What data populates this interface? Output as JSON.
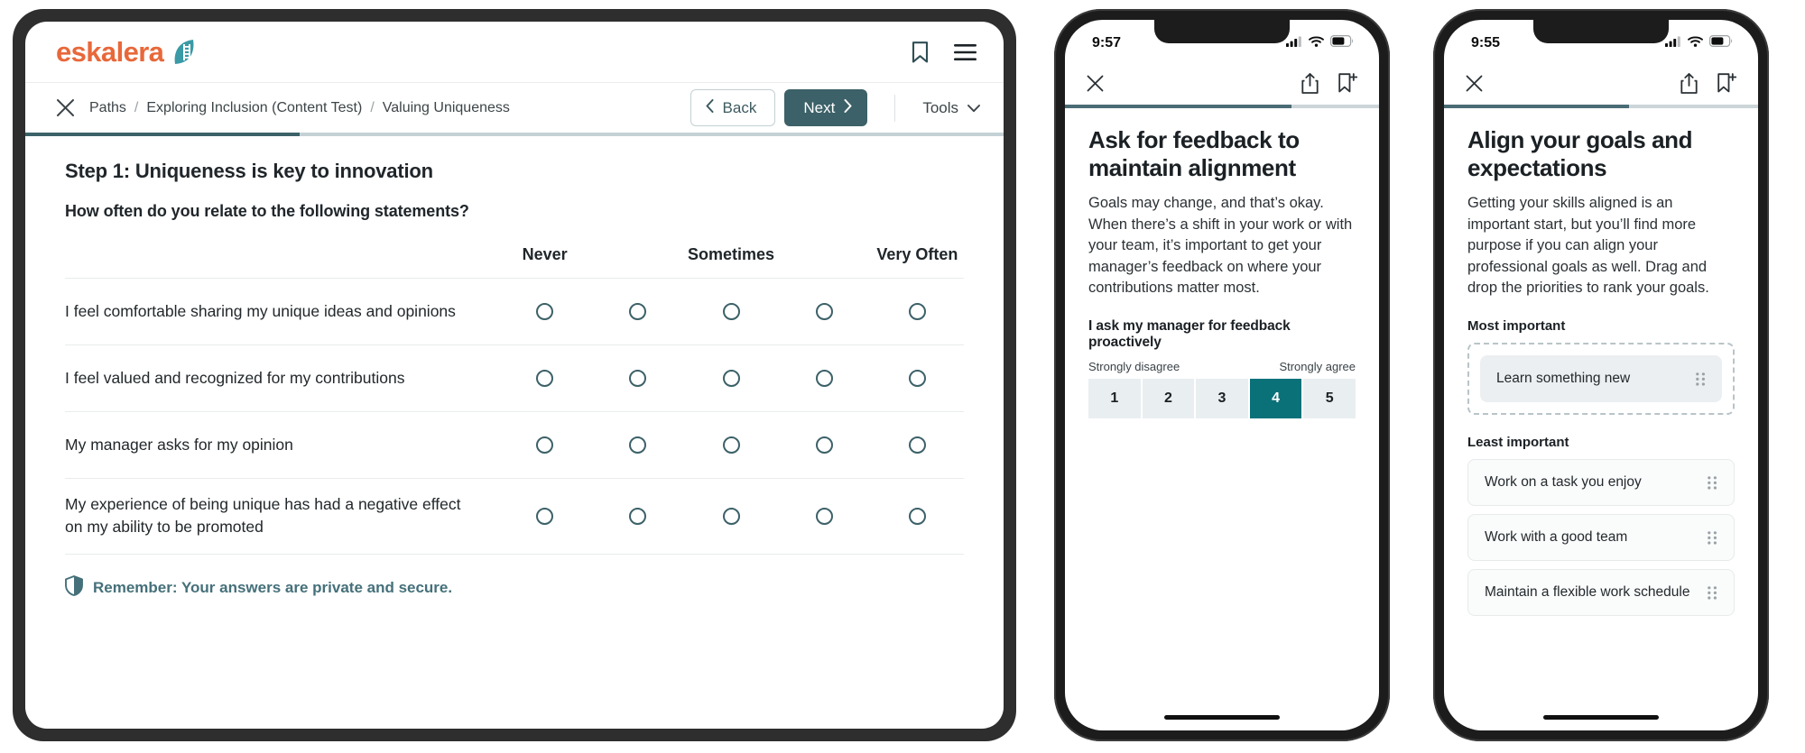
{
  "colors": {
    "brand_orange": "#e8683a",
    "teal": "#3c6168",
    "teal_dark": "#0b7179",
    "privacy_text": "#45707a"
  },
  "web": {
    "brand_name": "eskalera",
    "brand_mark_icon": "eskalera-leaf-logo-icon",
    "header_icons": [
      {
        "name": "bookmark-icon"
      },
      {
        "name": "hamburger-menu-icon"
      }
    ],
    "breadcrumb": {
      "close_icon": "close-x-icon",
      "items": [
        "Paths",
        "Exploring Inclusion (Content Test)",
        "Valuing Uniqueness"
      ],
      "separator": "/"
    },
    "nav": {
      "back_label": "Back",
      "back_icon": "chevron-left-icon",
      "next_label": "Next",
      "next_icon": "chevron-right-icon",
      "tools_label": "Tools",
      "tools_icon": "chevron-down-icon"
    },
    "progress_percent": 28,
    "survey": {
      "step_title": "Step 1: Uniqueness is key to innovation",
      "step_subtitle": "How often do you relate to the following statements?",
      "columns": [
        "Never",
        "Sometimes",
        "Very Often"
      ],
      "scale_points": 5,
      "statements": [
        "I feel comfortable sharing my unique ideas and opinions",
        "I feel valued and recognized for my contributions",
        "My manager asks for my opinion",
        "My experience of being unique has had a negative effect on my ability to be promoted"
      ],
      "selected": [
        null,
        null,
        null,
        null
      ],
      "privacy_icon": "shield-icon",
      "privacy_note": "Remember: Your answers are private and secure."
    }
  },
  "phone1": {
    "status": {
      "time": "9:57",
      "signal_icon": "cellular-signal-icon",
      "wifi_icon": "wifi-icon",
      "battery_icon": "battery-icon"
    },
    "topbar": {
      "close_icon": "close-x-icon",
      "share_icon": "share-upload-icon",
      "bookmark_add_icon": "bookmark-add-icon"
    },
    "progress_percent": 72,
    "title": "Ask for feedback to maintain alignment",
    "body": "Goals may change, and that’s okay. When there’s a shift in your work or with your team, it’s important to get your manager’s feedback on where your contributions matter most.",
    "likert": {
      "question": "I ask my manager for feedback proactively",
      "left_label": "Strongly disagree",
      "right_label": "Strongly agree",
      "options": [
        "1",
        "2",
        "3",
        "4",
        "5"
      ],
      "selected": "4"
    }
  },
  "phone2": {
    "status": {
      "time": "9:55",
      "signal_icon": "cellular-signal-icon",
      "wifi_icon": "wifi-icon",
      "battery_icon": "battery-icon"
    },
    "topbar": {
      "close_icon": "close-x-icon",
      "share_icon": "share-upload-icon",
      "bookmark_add_icon": "bookmark-add-icon"
    },
    "progress_percent": 59,
    "title": "Align your goals and expectations",
    "body": "Getting your skills aligned is an important start, but you’ll find more purpose if you can align your professional goals as well. Drag and drop the priorities to rank your goals.",
    "most_important_label": "Most important",
    "most_important_items": [
      "Learn something new"
    ],
    "least_important_label": "Least important",
    "least_important_items": [
      "Work on a task you enjoy",
      "Work with a good team",
      "Maintain a flexible work schedule"
    ],
    "grip_icon": "drag-handle-icon"
  }
}
